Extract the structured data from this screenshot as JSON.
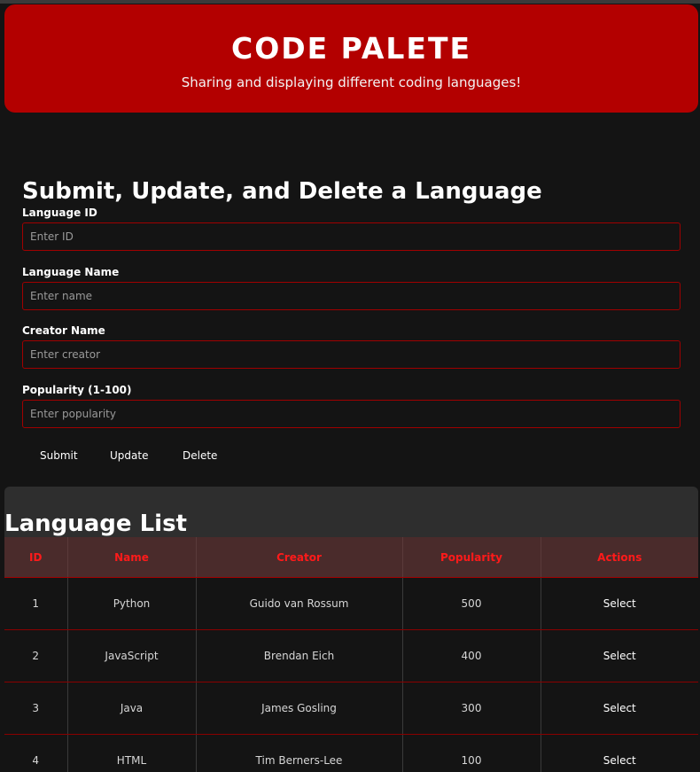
{
  "header": {
    "title": "CODE PALETE",
    "subtitle": "Sharing and displaying different coding languages!"
  },
  "form": {
    "title": "Submit, Update, and Delete a Language",
    "fields": [
      {
        "label": "Language ID",
        "placeholder": "Enter ID",
        "value": ""
      },
      {
        "label": "Language Name",
        "placeholder": "Enter name",
        "value": ""
      },
      {
        "label": "Creator Name",
        "placeholder": "Enter creator",
        "value": ""
      },
      {
        "label": "Popularity (1-100)",
        "placeholder": "Enter popularity",
        "value": ""
      }
    ],
    "buttons": {
      "submit": "Submit",
      "update": "Update",
      "delete": "Delete"
    }
  },
  "list": {
    "title": "Language List",
    "columns": [
      "ID",
      "Name",
      "Creator",
      "Popularity",
      "Actions"
    ],
    "rows": [
      {
        "id": "1",
        "name": "Python",
        "creator": "Guido van Rossum",
        "popularity": "500",
        "action": "Select"
      },
      {
        "id": "2",
        "name": "JavaScript",
        "creator": "Brendan Eich",
        "popularity": "400",
        "action": "Select"
      },
      {
        "id": "3",
        "name": "Java",
        "creator": "James Gosling",
        "popularity": "300",
        "action": "Select"
      },
      {
        "id": "4",
        "name": "HTML",
        "creator": "Tim Berners-Lee",
        "popularity": "100",
        "action": "Select"
      }
    ]
  },
  "colors": {
    "accent": "#b30000",
    "background": "#141414",
    "table_header_text": "#ff1a1a"
  }
}
